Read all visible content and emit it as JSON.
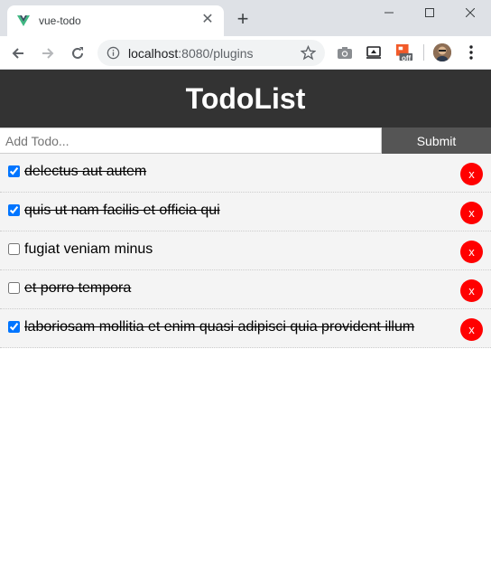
{
  "browser": {
    "tab": {
      "title": "vue-todo",
      "favicon": "vue-logo-icon"
    },
    "url": {
      "host": "localhost",
      "rest": ":8080/plugins"
    },
    "extensions": [
      "camera-icon",
      "cast-icon",
      "off-extension-icon"
    ],
    "extension_badge": "off"
  },
  "app": {
    "title": "TodoList",
    "add_form": {
      "placeholder": "Add Todo...",
      "value": "",
      "submit_label": "Submit"
    },
    "todos": [
      {
        "title": "delectus aut autem",
        "completed": true,
        "checked": true,
        "delete_label": "x"
      },
      {
        "title": "quis ut nam facilis et officia qui",
        "completed": true,
        "checked": true,
        "delete_label": "x"
      },
      {
        "title": "fugiat veniam minus",
        "completed": false,
        "checked": false,
        "delete_label": "x"
      },
      {
        "title": "et porro tempora",
        "completed": true,
        "checked": false,
        "delete_label": "x"
      },
      {
        "title": "laboriosam mollitia et enim quasi adipisci quia provident illum",
        "completed": true,
        "checked": true,
        "delete_label": "x"
      }
    ]
  },
  "colors": {
    "header_bg": "#333333",
    "submit_bg": "#555555",
    "delete_bg": "#ff0000",
    "item_bg": "#f4f4f4"
  }
}
